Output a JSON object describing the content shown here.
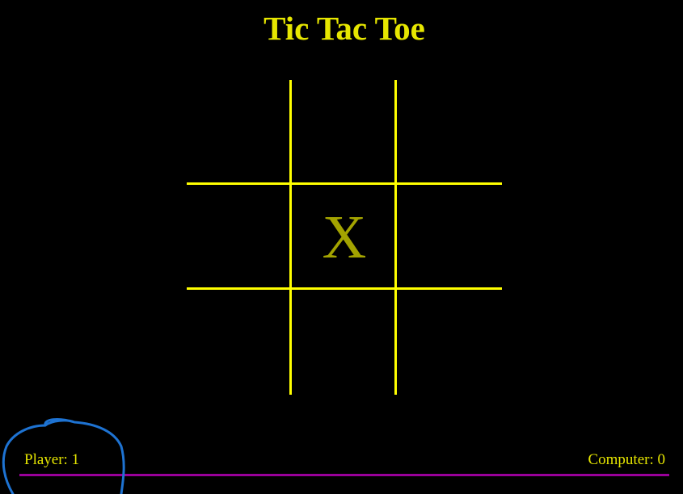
{
  "title": "Tic Tac Toe",
  "board": {
    "cells": [
      "",
      "",
      "",
      "",
      "X",
      "",
      "",
      "",
      ""
    ]
  },
  "score": {
    "player": "Player: 1",
    "computer": "Computer: 0"
  },
  "colors": {
    "background": "#000000",
    "grid": "#ffff00",
    "title": "#e6e600",
    "mark": "#a3a300",
    "score_text": "#e6e600",
    "divider": "#990099",
    "annotation": "#1e73d2"
  }
}
